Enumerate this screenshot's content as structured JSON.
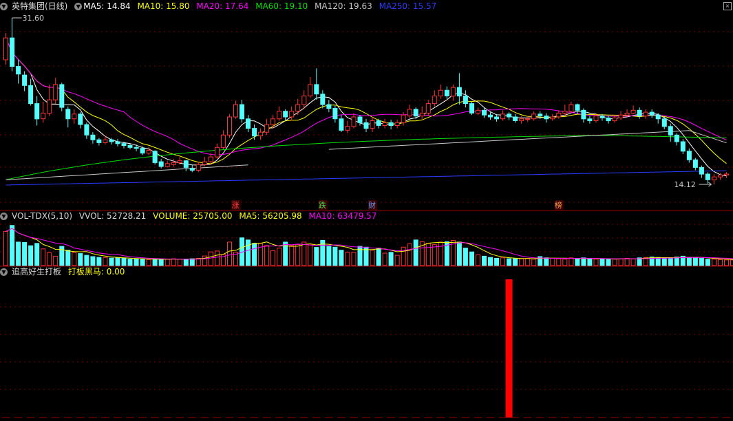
{
  "colors": {
    "up": "#ff3333",
    "down": "#54fcfc",
    "ma5": "#ffffff",
    "ma10": "#ffff00",
    "ma20": "#ff00ff",
    "ma60": "#00e000",
    "ma120": "#c8c8c8",
    "ma250": "#2a3cff",
    "grid": "#7a0000",
    "bar": "#ff0000"
  },
  "main": {
    "stock": "英特集团(日线)",
    "ma5": "MA5: 14.84",
    "ma10": "MA10: 15.80",
    "ma20": "MA20: 17.64",
    "ma60": "MA60: 19.10",
    "ma120": "MA120: 19.63",
    "ma250": "MA250: 15.57",
    "high_label": "31.60",
    "low_label": "14.12",
    "tags": [
      "涨",
      "跌",
      "财",
      "榜"
    ]
  },
  "vol": {
    "name": "VOL-TDX(5,10)",
    "vvol": "VVOL: 52728.21",
    "volume": "VOLUME: 25705.00",
    "ma5": "MA5: 56205.98",
    "ma10": "MA10: 63479.57"
  },
  "ind": {
    "name": "追高好生打板",
    "value": "打板黑马: 0.00"
  },
  "chart_data": [
    {
      "type": "candlestick",
      "title": "英特集团(日线)",
      "price_range": [
        14.12,
        31.6
      ],
      "candles": [
        [
          27.2,
          29.5,
          30.0,
          26.7
        ],
        [
          29.5,
          26.5,
          31.6,
          26.0
        ],
        [
          26.5,
          25.7,
          27.2,
          24.7
        ],
        [
          25.6,
          24.5,
          26.0,
          23.9
        ],
        [
          24.5,
          22.6,
          25.2,
          22.4
        ],
        [
          22.6,
          21.0,
          23.4,
          20.3
        ],
        [
          21.0,
          21.6,
          22.8,
          20.6
        ],
        [
          21.6,
          23.0,
          24.6,
          21.3
        ],
        [
          23.0,
          24.6,
          25.3,
          22.6
        ],
        [
          24.6,
          22.2,
          24.8,
          21.8
        ],
        [
          22.0,
          21.0,
          22.3,
          20.1
        ],
        [
          21.0,
          21.5,
          22.0,
          20.5
        ],
        [
          21.5,
          20.4,
          21.7,
          20.0
        ],
        [
          20.4,
          19.3,
          20.6,
          18.9
        ],
        [
          19.3,
          18.8,
          19.6,
          18.4
        ],
        [
          18.8,
          18.5,
          19.0,
          18.2
        ],
        [
          18.5,
          18.8,
          19.2,
          18.3
        ],
        [
          18.8,
          18.6,
          19.0,
          18.3
        ],
        [
          18.6,
          18.4,
          18.9,
          18.1
        ],
        [
          18.4,
          18.2,
          18.6,
          17.9
        ],
        [
          18.2,
          18.0,
          18.4,
          17.8
        ],
        [
          18.0,
          17.9,
          18.3,
          17.6
        ],
        [
          17.9,
          17.4,
          18.1,
          17.2
        ],
        [
          17.4,
          17.7,
          18.0,
          17.2
        ],
        [
          17.6,
          16.4,
          17.7,
          16.2
        ],
        [
          16.5,
          16.0,
          16.8,
          15.8
        ],
        [
          16.0,
          16.3,
          16.6,
          15.9
        ],
        [
          16.2,
          16.4,
          16.8,
          16.0
        ],
        [
          16.4,
          16.6,
          17.0,
          16.2
        ],
        [
          16.6,
          15.9,
          16.7,
          15.5
        ],
        [
          15.8,
          15.6,
          16.2,
          15.4
        ],
        [
          15.6,
          16.2,
          16.5,
          15.4
        ],
        [
          16.2,
          16.5,
          17.0,
          16.0
        ],
        [
          16.5,
          17.0,
          17.4,
          16.2
        ],
        [
          17.0,
          18.0,
          18.4,
          16.8
        ],
        [
          18.0,
          19.3,
          19.8,
          17.8
        ],
        [
          19.3,
          21.2,
          21.5,
          19.0
        ],
        [
          21.2,
          22.5,
          22.9,
          21.0
        ],
        [
          22.5,
          21.0,
          23.0,
          20.6
        ],
        [
          21.0,
          20.0,
          21.4,
          19.6
        ],
        [
          20.0,
          19.2,
          20.4,
          18.8
        ],
        [
          19.2,
          19.6,
          20.0,
          18.8
        ],
        [
          19.6,
          20.4,
          21.0,
          19.3
        ],
        [
          20.4,
          21.0,
          21.4,
          20.0
        ],
        [
          21.0,
          21.8,
          22.3,
          20.8
        ],
        [
          21.8,
          21.2,
          22.0,
          20.8
        ],
        [
          21.2,
          21.8,
          22.3,
          20.8
        ],
        [
          21.8,
          22.5,
          23.1,
          21.4
        ],
        [
          22.5,
          23.4,
          24.0,
          22.0
        ],
        [
          23.4,
          24.6,
          25.4,
          23.2
        ],
        [
          24.6,
          23.6,
          26.3,
          23.0
        ],
        [
          23.6,
          22.5,
          24.0,
          22.1
        ],
        [
          22.5,
          22.1,
          23.0,
          21.7
        ],
        [
          22.1,
          21.0,
          22.4,
          20.6
        ],
        [
          21.0,
          19.8,
          21.4,
          19.6
        ],
        [
          19.8,
          20.2,
          20.8,
          19.5
        ],
        [
          20.2,
          21.2,
          21.6,
          20.0
        ],
        [
          21.2,
          20.6,
          21.4,
          20.3
        ],
        [
          20.6,
          20.0,
          21.0,
          19.6
        ],
        [
          20.0,
          20.8,
          21.2,
          19.6
        ],
        [
          20.8,
          20.3,
          21.0,
          20.0
        ],
        [
          20.3,
          20.6,
          21.0,
          20.0
        ],
        [
          20.6,
          20.3,
          20.9,
          19.9
        ],
        [
          20.3,
          20.6,
          20.9,
          20.0
        ],
        [
          20.6,
          21.4,
          21.7,
          20.3
        ],
        [
          21.3,
          22.0,
          22.5,
          21.1
        ],
        [
          22.0,
          21.3,
          22.2,
          21.0
        ],
        [
          21.3,
          21.6,
          22.3,
          21.0
        ],
        [
          21.6,
          22.6,
          23.0,
          21.3
        ],
        [
          22.6,
          23.4,
          24.0,
          22.3
        ],
        [
          23.4,
          24.0,
          24.6,
          23.1
        ],
        [
          24.0,
          23.4,
          24.4,
          23.1
        ],
        [
          23.4,
          24.3,
          24.6,
          22.9
        ],
        [
          24.3,
          23.4,
          25.8,
          22.5
        ],
        [
          23.4,
          22.6,
          24.0,
          22.2
        ],
        [
          22.6,
          21.6,
          22.8,
          21.4
        ],
        [
          21.6,
          21.9,
          22.2,
          21.4
        ],
        [
          21.9,
          21.4,
          22.2,
          21.1
        ],
        [
          21.4,
          21.2,
          21.7,
          20.9
        ],
        [
          21.2,
          21.0,
          21.5,
          20.7
        ],
        [
          21.0,
          21.5,
          21.9,
          20.8
        ],
        [
          21.5,
          21.2,
          21.7,
          20.9
        ],
        [
          21.2,
          20.8,
          21.5,
          20.6
        ],
        [
          20.8,
          21.0,
          21.3,
          20.5
        ],
        [
          21.0,
          21.0,
          21.3,
          20.7
        ],
        [
          21.0,
          21.5,
          21.8,
          20.8
        ],
        [
          21.5,
          21.3,
          21.8,
          21.0
        ],
        [
          21.3,
          21.0,
          21.6,
          20.6
        ],
        [
          21.0,
          21.2,
          21.5,
          20.8
        ],
        [
          21.2,
          21.6,
          21.9,
          21.0
        ],
        [
          21.6,
          21.8,
          22.5,
          21.3
        ],
        [
          21.8,
          22.5,
          22.8,
          21.6
        ],
        [
          22.5,
          21.9,
          22.6,
          21.5
        ],
        [
          21.9,
          21.0,
          22.1,
          20.6
        ],
        [
          21.0,
          20.8,
          21.3,
          20.5
        ],
        [
          20.8,
          21.3,
          21.6,
          20.6
        ],
        [
          21.3,
          21.1,
          21.5,
          20.8
        ],
        [
          21.1,
          20.8,
          21.3,
          20.5
        ],
        [
          20.8,
          21.1,
          21.4,
          20.6
        ],
        [
          21.1,
          21.4,
          21.8,
          20.9
        ],
        [
          21.4,
          21.6,
          22.0,
          21.2
        ],
        [
          21.6,
          21.9,
          22.4,
          21.5
        ],
        [
          21.9,
          21.3,
          22.2,
          21.0
        ],
        [
          21.3,
          21.7,
          22.0,
          21.0
        ],
        [
          21.7,
          21.4,
          22.0,
          21.1
        ],
        [
          21.4,
          21.0,
          21.6,
          20.5
        ],
        [
          21.0,
          20.2,
          21.2,
          19.9
        ],
        [
          20.2,
          19.3,
          20.5,
          18.6
        ],
        [
          19.3,
          18.6,
          19.5,
          18.2
        ],
        [
          18.6,
          17.6,
          18.9,
          17.3
        ],
        [
          17.6,
          16.7,
          17.9,
          16.4
        ],
        [
          16.7,
          15.9,
          16.9,
          15.6
        ],
        [
          15.9,
          15.2,
          16.1,
          14.8
        ],
        [
          15.2,
          14.6,
          15.4,
          14.2
        ],
        [
          14.6,
          14.9,
          15.2,
          14.12
        ],
        [
          14.9,
          15.1,
          15.3,
          14.6
        ],
        [
          15.1,
          15.2,
          15.4,
          14.8
        ]
      ],
      "ma120_tail": [
        [
          0,
          14.6
        ],
        [
          40,
          16.2
        ]
      ],
      "ma250_tail": [
        [
          0,
          14.1
        ],
        [
          120,
          17.0
        ]
      ]
    },
    {
      "type": "bar",
      "title": "VOL-TDX(5,10)",
      "ylim": [
        0,
        200000
      ],
      "values": [
        160000,
        188000,
        110000,
        108000,
        93000,
        104000,
        78000,
        60000,
        44000,
        90000,
        72000,
        60000,
        56000,
        48000,
        42000,
        38000,
        38000,
        35000,
        36000,
        34000,
        30000,
        30000,
        30000,
        28000,
        30000,
        28000,
        30000,
        32000,
        30000,
        30000,
        32000,
        34000,
        45000,
        64000,
        68000,
        52000,
        110000,
        62000,
        130000,
        120000,
        104000,
        105000,
        94000,
        70000,
        82000,
        110000,
        94000,
        98000,
        110000,
        96000,
        85000,
        118000,
        90000,
        86000,
        72000,
        62000,
        62000,
        90000,
        86000,
        72000,
        82000,
        58000,
        62000,
        48000,
        86000,
        102000,
        120000,
        112000,
        104000,
        98000,
        110000,
        112000,
        118000,
        110000,
        82000,
        64000,
        50000,
        44000,
        38000,
        34000,
        36000,
        32000,
        32000,
        32000,
        34000,
        30000,
        42000,
        36000,
        34000,
        32000,
        30000,
        36000,
        34000,
        36000,
        30000,
        30000,
        32000,
        30000,
        30000,
        32000,
        34000,
        32000,
        36000,
        38000,
        40000,
        38000,
        34000,
        36000,
        40000,
        44000,
        38000,
        36000,
        34000,
        30000,
        30000,
        28000,
        26000,
        26000,
        25705
      ]
    },
    {
      "type": "bar",
      "title": "追高好生打板",
      "series": [
        {
          "name": "打板黑马",
          "x": [
            81
          ],
          "values": [
            1
          ]
        }
      ]
    }
  ]
}
